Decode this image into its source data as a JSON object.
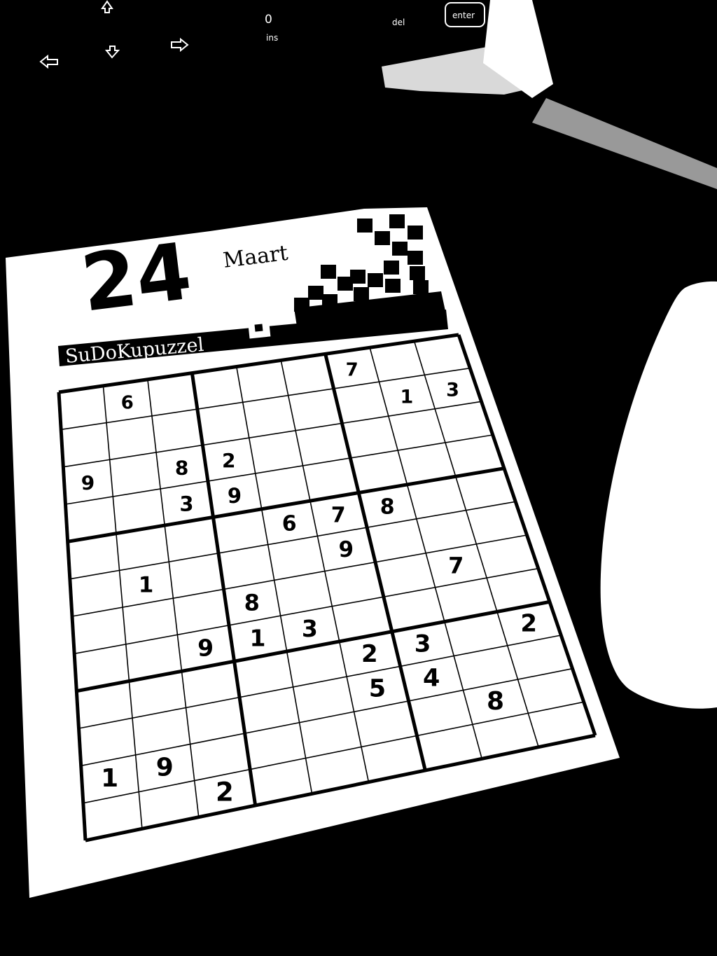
{
  "keyboard": {
    "keys": [
      {
        "label": "0"
      },
      {
        "label": "ins"
      },
      {
        "label": "del"
      },
      {
        "label": "enter"
      }
    ],
    "arrow_icons": [
      "arrow-up-icon",
      "arrow-left-icon",
      "arrow-down-icon",
      "arrow-right-icon"
    ]
  },
  "calendar": {
    "day": "24",
    "month": "Maart",
    "puzzle_title": "SuDoKupuzzel",
    "grid": [
      [
        "",
        "6",
        "",
        "",
        "",
        "",
        "7",
        "",
        ""
      ],
      [
        "",
        "",
        "",
        "",
        "",
        "",
        "",
        "1",
        "3"
      ],
      [
        "9",
        "",
        "8",
        "2",
        "",
        "",
        "",
        "",
        ""
      ],
      [
        "",
        "",
        "3",
        "9",
        "",
        "",
        "",
        "",
        ""
      ],
      [
        "",
        "",
        "",
        "",
        "6",
        "7",
        "8",
        "",
        ""
      ],
      [
        "",
        "1",
        "",
        "",
        "",
        "9",
        "",
        "",
        ""
      ],
      [
        "",
        "",
        "",
        "8",
        "",
        "",
        "",
        "7",
        ""
      ],
      [
        "",
        "",
        "9",
        "1",
        "3",
        "",
        "",
        "",
        ""
      ],
      [
        "",
        "",
        "",
        "",
        "",
        "2",
        "3",
        "",
        "2"
      ],
      [
        "",
        "",
        "",
        "",
        "",
        "5",
        "4",
        "",
        ""
      ],
      [
        "1",
        "9",
        "",
        "",
        "",
        "",
        "",
        "8",
        ""
      ],
      [
        "",
        "",
        "2",
        "",
        "",
        "",
        "",
        "",
        ""
      ]
    ]
  },
  "colors": {
    "background": "#000000",
    "paper": "#ffffff",
    "ink": "#000000"
  }
}
